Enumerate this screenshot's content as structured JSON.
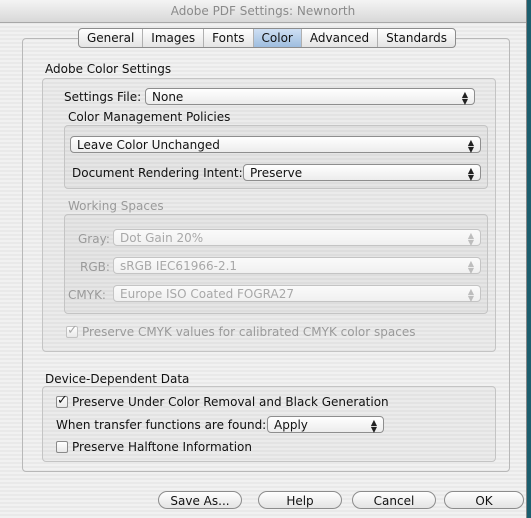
{
  "window": {
    "title": "Adobe PDF Settings: Newnorth"
  },
  "tabs": [
    {
      "label": "General",
      "selected": false
    },
    {
      "label": "Images",
      "selected": false
    },
    {
      "label": "Fonts",
      "selected": false
    },
    {
      "label": "Color",
      "selected": true
    },
    {
      "label": "Advanced",
      "selected": false
    },
    {
      "label": "Standards",
      "selected": false
    }
  ],
  "color_settings": {
    "section_title": "Adobe Color Settings",
    "settings_file_label": "Settings File:",
    "settings_file_value": "None",
    "policies_title": "Color Management Policies",
    "policy_value": "Leave Color Unchanged",
    "rendering_intent_label": "Document Rendering Intent:",
    "rendering_intent_value": "Preserve",
    "working_spaces_title": "Working Spaces",
    "gray_label": "Gray:",
    "gray_value": "Dot Gain 20%",
    "rgb_label": "RGB:",
    "rgb_value": "sRGB IEC61966-2.1",
    "cmyk_label": "CMYK:",
    "cmyk_value": "Europe ISO Coated FOGRA27",
    "preserve_cmyk_label": "Preserve CMYK values for calibrated CMYK color spaces",
    "preserve_cmyk_checked": true
  },
  "device_data": {
    "section_title": "Device-Dependent Data",
    "ucr_label": "Preserve Under Color Removal and Black Generation",
    "ucr_checked": true,
    "transfer_label": "When transfer functions are found:",
    "transfer_value": "Apply",
    "halftone_label": "Preserve Halftone Information",
    "halftone_checked": false
  },
  "buttons": {
    "save_as": "Save As...",
    "help": "Help",
    "cancel": "Cancel",
    "ok": "OK"
  },
  "glyphs": {
    "popup_arrows_up": "▲",
    "popup_arrows_down": "▼",
    "check": "✓"
  }
}
